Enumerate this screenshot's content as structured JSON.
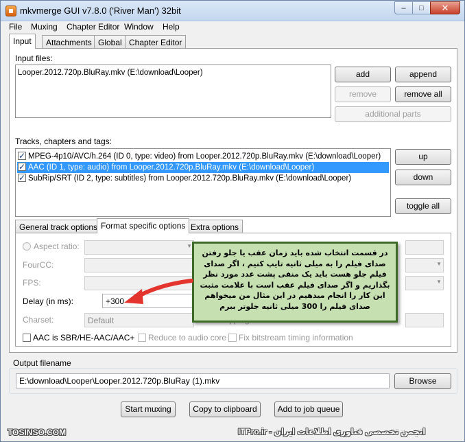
{
  "window": {
    "title": "mkvmerge GUI v7.8.0 ('River Man') 32bit",
    "minimize": "–",
    "maximize": "□",
    "close": "✕"
  },
  "menu": [
    "File",
    "Muxing",
    "Chapter Editor",
    "Window",
    "Help"
  ],
  "tabs": [
    "Input",
    "Attachments",
    "Global",
    "Chapter Editor"
  ],
  "input_files": {
    "label": "Input files:",
    "items": [
      "Looper.2012.720p.BluRay.mkv (E:\\download\\Looper)"
    ]
  },
  "file_buttons": {
    "add": "add",
    "append": "append",
    "remove": "remove",
    "remove_all": "remove all",
    "additional_parts": "additional parts"
  },
  "tracks": {
    "label": "Tracks, chapters and tags:",
    "items": [
      "MPEG-4p10/AVC/h.264 (ID 0, type: video) from Looper.2012.720p.BluRay.mkv (E:\\download\\Looper)",
      "AAC (ID 1, type: audio) from Looper.2012.720p.BluRay.mkv (E:\\download\\Looper)",
      "SubRip/SRT (ID 2, type: subtitles) from Looper.2012.720p.BluRay.mkv (E:\\download\\Looper)"
    ]
  },
  "track_buttons": {
    "up": "up",
    "down": "down",
    "toggle_all": "toggle all"
  },
  "subtabs": [
    "General track options",
    "Format specific options",
    "Extra options"
  ],
  "format_options": {
    "aspect_ratio": "Aspect ratio:",
    "fourcc": "FourCC:",
    "fps": "FPS:",
    "delay_label": "Delay (in ms):",
    "delay_value": "+300",
    "charset_label": "Charset:",
    "charset_value": "Default",
    "cropping_label": "Cropping:",
    "aac_sbr": "AAC is SBR/HE-AAC/AAC+",
    "reduce_audio_core": "Reduce to audio core",
    "fix_bitstream": "Fix bitstream timing information"
  },
  "note": {
    "text": "در قسمت انتخاب شده باید زمان عقب یا جلو رفتن صدای فیلم را به میلی ثانیه تایپ کنیم ، اگر صدای فیلم جلو هست باید یک منفی پشت عدد مورد نظر بگذاریم و اگر صدای فیلم عقب است با علامت مثبت این کار را انجام میدهیم در این مثال من میخواهم صدای فیلم را 300 میلی ثانیه جلوتر ببرم"
  },
  "output": {
    "label": "Output filename",
    "value": "E:\\download\\Looper\\Looper.2012.720p.BluRay (1).mkv",
    "browse": "Browse"
  },
  "actions": {
    "start": "Start muxing",
    "copy": "Copy to clipboard",
    "add_job": "Add to job queue"
  },
  "watermark": {
    "left": "TOSINSO.COM",
    "right": "ITPro.ir - انجمن تخصصی فناوری اطلاعات ایران"
  }
}
